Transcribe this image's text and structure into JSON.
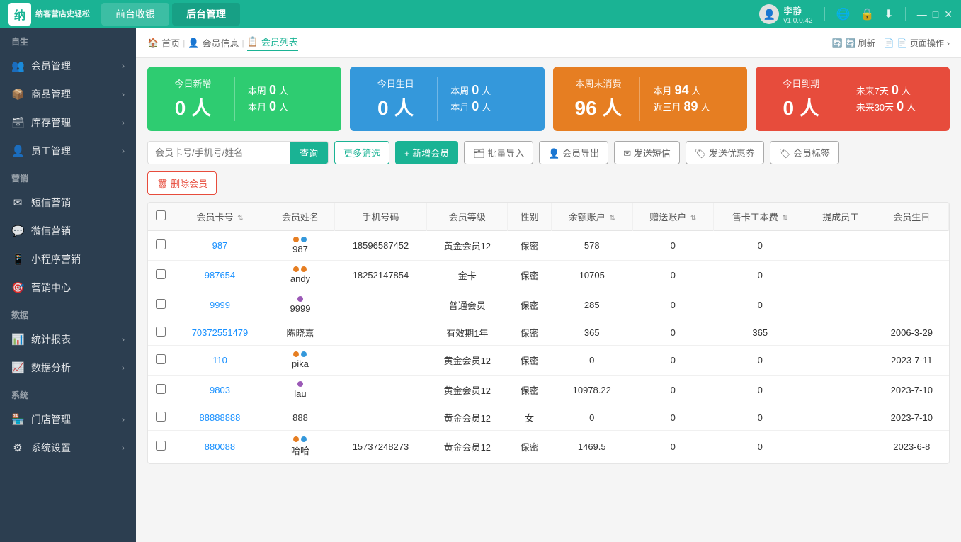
{
  "header": {
    "logo_char": "纳",
    "logo_tagline": "纳客营店史轻松",
    "nav_tabs": [
      {
        "label": "前台收银",
        "active": false
      },
      {
        "label": "后台管理",
        "active": true
      }
    ],
    "user": {
      "name": "李静",
      "version": "v1.0.0.42",
      "avatar": "👤"
    },
    "controls": [
      "—",
      "□",
      "✕"
    ]
  },
  "sidebar": {
    "sections": [
      {
        "title": "自生",
        "items": []
      },
      {
        "title": "",
        "items": [
          {
            "icon": "👥",
            "label": "会员管理",
            "arrow": true
          },
          {
            "icon": "📦",
            "label": "商品管理",
            "arrow": true
          },
          {
            "icon": "🗃️",
            "label": "库存管理",
            "arrow": true
          },
          {
            "icon": "👤",
            "label": "员工管理",
            "arrow": true
          }
        ]
      },
      {
        "title": "营销",
        "items": [
          {
            "icon": "✉️",
            "label": "短信营销",
            "arrow": false
          },
          {
            "icon": "💬",
            "label": "微信营销",
            "arrow": false
          },
          {
            "icon": "📱",
            "label": "小程序营销",
            "arrow": false
          },
          {
            "icon": "🎯",
            "label": "营销中心",
            "arrow": false
          }
        ]
      },
      {
        "title": "数据",
        "items": [
          {
            "icon": "📊",
            "label": "统计报表",
            "arrow": true
          },
          {
            "icon": "📈",
            "label": "数据分析",
            "arrow": true
          }
        ]
      },
      {
        "title": "系统",
        "items": [
          {
            "icon": "🏪",
            "label": "门店管理",
            "arrow": true
          },
          {
            "icon": "⚙️",
            "label": "系统设置",
            "arrow": true
          }
        ]
      }
    ]
  },
  "breadcrumb": {
    "items": [
      {
        "label": "🏠 首页",
        "active": false
      },
      {
        "label": "👤 会员信息",
        "active": false
      },
      {
        "label": "📋 会员列表",
        "active": true
      }
    ],
    "actions": [
      {
        "label": "🔄 刷新"
      },
      {
        "label": "📄 页面操作"
      }
    ]
  },
  "stats": [
    {
      "color": "green",
      "title": "今日新增",
      "number": "0 人",
      "right_lines": [
        {
          "label": "本周",
          "value": "0",
          "unit": "人"
        },
        {
          "label": "本月",
          "value": "0",
          "unit": "人"
        }
      ]
    },
    {
      "color": "blue",
      "title": "今日生日",
      "number": "0 人",
      "right_lines": [
        {
          "label": "本周",
          "value": "0",
          "unit": "人"
        },
        {
          "label": "本月",
          "value": "0",
          "unit": "人"
        }
      ]
    },
    {
      "color": "orange",
      "title": "本周末消费",
      "number": "96 人",
      "right_lines": [
        {
          "label": "本月",
          "value": "94",
          "unit": "人"
        },
        {
          "label": "近三月",
          "value": "89",
          "unit": "人"
        }
      ]
    },
    {
      "color": "red",
      "title": "今日到期",
      "number": "0 人",
      "right_lines": [
        {
          "label": "未来7天",
          "value": "0",
          "unit": "人"
        },
        {
          "label": "未来30天",
          "value": "0",
          "unit": "人"
        }
      ]
    }
  ],
  "toolbar": {
    "search_placeholder": "会员卡号/手机号/姓名",
    "search_btn": "查询",
    "buttons": [
      {
        "label": "更多筛选",
        "type": "outline"
      },
      {
        "label": "+ 新增会员",
        "type": "primary"
      },
      {
        "label": "🗂 批量导入",
        "type": "gray"
      },
      {
        "label": "👤 会员导出",
        "type": "gray"
      },
      {
        "label": "✉ 发送短信",
        "type": "gray"
      },
      {
        "label": "🏷 发送优惠券",
        "type": "gray"
      },
      {
        "label": "🏷 会员标签",
        "type": "gray"
      }
    ],
    "delete_btn": "🗑 删除会员"
  },
  "table": {
    "columns": [
      "会员卡号",
      "会员姓名",
      "手机号码",
      "会员等级",
      "性别",
      "余额账户",
      "赠送账户",
      "售卡工本费",
      "提成员工",
      "会员生日"
    ],
    "rows": [
      {
        "id": "987",
        "dots": [
          "orange",
          "blue"
        ],
        "name": "987",
        "phone": "18596587452",
        "level": "黄金会员12",
        "gender": "保密",
        "balance": "578",
        "gift": "0",
        "card_fee": "0",
        "promoter": "",
        "birthday": ""
      },
      {
        "id": "987654",
        "dots": [
          "orange",
          "orange"
        ],
        "name": "andy",
        "phone": "18252147854",
        "level": "金卡",
        "gender": "保密",
        "balance": "10705",
        "gift": "0",
        "card_fee": "0",
        "promoter": "",
        "birthday": ""
      },
      {
        "id": "9999",
        "dots": [
          "purple"
        ],
        "name": "9999",
        "phone": "",
        "level": "普通会员",
        "gender": "保密",
        "balance": "285",
        "gift": "0",
        "card_fee": "0",
        "promoter": "",
        "birthday": ""
      },
      {
        "id": "70372551479",
        "dots": [],
        "name": "陈晓嘉",
        "phone": "",
        "level": "有效期1年",
        "gender": "保密",
        "balance": "365",
        "gift": "0",
        "card_fee": "365",
        "promoter": "",
        "birthday": "2006-3-29"
      },
      {
        "id": "110",
        "dots": [
          "orange",
          "blue"
        ],
        "name": "pika",
        "phone": "",
        "level": "黄金会员12",
        "gender": "保密",
        "balance": "0",
        "gift": "0",
        "card_fee": "0",
        "promoter": "",
        "birthday": "2023-7-11"
      },
      {
        "id": "9803",
        "dots": [
          "purple"
        ],
        "name": "lau",
        "phone": "",
        "level": "黄金会员12",
        "gender": "保密",
        "balance": "10978.22",
        "gift": "0",
        "card_fee": "0",
        "promoter": "",
        "birthday": "2023-7-10"
      },
      {
        "id": "88888888",
        "dots": [],
        "name": "888",
        "phone": "",
        "level": "黄金会员12",
        "gender": "女",
        "balance": "0",
        "gift": "0",
        "card_fee": "0",
        "promoter": "",
        "birthday": "2023-7-10"
      },
      {
        "id": "880088",
        "dots": [
          "orange",
          "blue"
        ],
        "name": "哈哈",
        "phone": "15737248273",
        "level": "黄金会员12",
        "gender": "保密",
        "balance": "1469.5",
        "gift": "0",
        "card_fee": "0",
        "promoter": "",
        "birthday": "2023-6-8"
      }
    ]
  }
}
